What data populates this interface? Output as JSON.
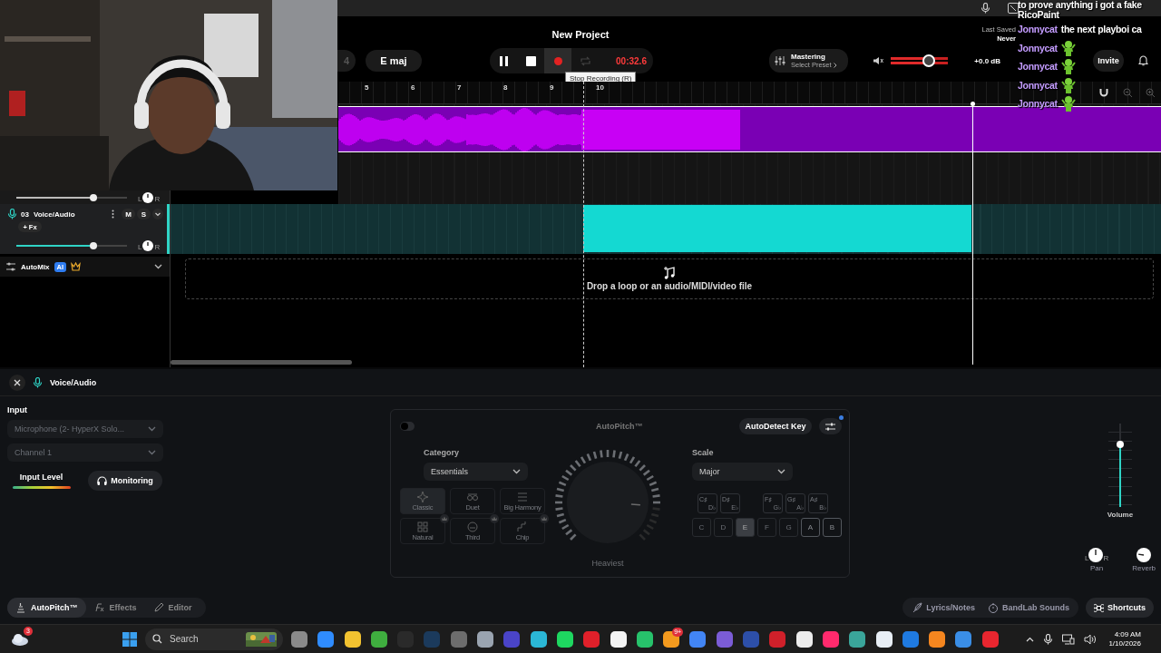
{
  "chat": [
    {
      "kind": "text",
      "text": "to prove anything i got a fake"
    },
    {
      "kind": "text",
      "text": "RicoPaint"
    },
    {
      "kind": "message",
      "user": "Jonnycat",
      "text": "the next playboi ca"
    },
    {
      "kind": "emote",
      "user": "Jonnycat"
    },
    {
      "kind": "emote",
      "user": "Jonnycat"
    },
    {
      "kind": "emote",
      "user": "Jonnycat"
    },
    {
      "kind": "emote",
      "user": "Jonnycat"
    }
  ],
  "toolbar": {
    "title": "New Project",
    "bar": "4",
    "key": "E maj",
    "transport": [
      {
        "kind": "pause",
        "on": false,
        "disabled": false
      },
      {
        "kind": "stop",
        "on": false,
        "disabled": false
      },
      {
        "kind": "record",
        "on": true,
        "disabled": false
      },
      {
        "kind": "loop",
        "on": false,
        "disabled": true
      }
    ],
    "time": "00:32.6",
    "tooltip": "Stop Recording (R)",
    "mastering": {
      "title": "Mastering",
      "subtitle": "Select Preset"
    },
    "master_volume": {
      "level": 0.67
    },
    "gain": "+0.0 dB",
    "last_saved": {
      "label": "Last Saved",
      "value": "Never"
    },
    "invite": "Invite"
  },
  "ruler": {
    "labels": [
      "5",
      "6",
      "7",
      "8",
      "9",
      "10"
    ]
  },
  "tracks": [
    {
      "color": "#7a00b4"
    },
    {
      "volume": {
        "level": 0.7
      },
      "pan": {
        "left": "L",
        "right": "R"
      }
    },
    {
      "number": "03",
      "name": "Voice/Audio",
      "fx": "+ Fx",
      "mute": "M",
      "solo": "S",
      "selected": true,
      "color": "#14d9d2",
      "volume": {
        "level": 0.7
      },
      "pan": {
        "left": "L",
        "right": "R"
      }
    }
  ],
  "automix": {
    "label": "AutoMix",
    "badge": "AI"
  },
  "drop_zone": {
    "text": "Drop a loop or an audio/MIDI/video file"
  },
  "editor": {
    "track": {
      "name": "Voice/Audio"
    },
    "input": {
      "label": "Input",
      "device": "Microphone (2- HyperX Solo...",
      "channel": "Channel 1",
      "level_label": "Input Level",
      "monitoring": "Monitoring"
    },
    "autopitch": {
      "enabled": false,
      "title": "AutoPitch™",
      "autodetect": "AutoDetect Key",
      "category_label": "Category",
      "category": "Essentials",
      "presets": [
        {
          "label": "Classic",
          "selected": true,
          "locked": false
        },
        {
          "label": "Duet",
          "selected": false,
          "locked": false
        },
        {
          "label": "Big Harmony",
          "selected": false,
          "locked": false
        },
        {
          "label": "Natural",
          "selected": false,
          "locked": true
        },
        {
          "label": "Third",
          "selected": false,
          "locked": true
        },
        {
          "label": "Chip",
          "selected": false,
          "locked": true
        }
      ],
      "knob": {
        "label": "Heaviest"
      },
      "scale_label": "Scale",
      "scale": "Major",
      "sharps": [
        {
          "top": "C♯",
          "bottom": "D♭"
        },
        {
          "top": "D♯",
          "bottom": "E♭"
        },
        {
          "top": "F♯",
          "bottom": "G♭"
        },
        {
          "top": "G♯",
          "bottom": "A♭"
        },
        {
          "top": "A♯",
          "bottom": "B♭"
        }
      ],
      "notes": [
        {
          "label": "C",
          "selected": false,
          "highlighted": false
        },
        {
          "label": "D",
          "selected": false,
          "highlighted": false
        },
        {
          "label": "E",
          "selected": true,
          "highlighted": false
        },
        {
          "label": "F",
          "selected": false,
          "highlighted": false
        },
        {
          "label": "G",
          "selected": false,
          "highlighted": false
        },
        {
          "label": "A",
          "selected": false,
          "highlighted": true
        },
        {
          "label": "B",
          "selected": false,
          "highlighted": true
        }
      ]
    },
    "mixer": {
      "volume": {
        "label": "Volume",
        "level": 0.75
      },
      "pan": {
        "label": "Pan",
        "left": "L",
        "right": "R"
      },
      "reverb": {
        "label": "Reverb"
      }
    },
    "tabs": [
      {
        "label": "AutoPitch™",
        "selected": true
      },
      {
        "label": "Effects",
        "selected": false
      },
      {
        "label": "Editor",
        "selected": false
      }
    ],
    "links": [
      "Lyrics/Notes",
      "BandLab Sounds"
    ],
    "shortcuts": "Shortcuts"
  },
  "taskbar": {
    "weather_badge": "3",
    "search": {
      "placeholder": "Search"
    },
    "apps": [
      {
        "color": "#8a8a8a"
      },
      {
        "color": "#2f8cff"
      },
      {
        "color": "#f2c230"
      },
      {
        "color": "#3fae3f"
      },
      {
        "color": "#2a2a2a"
      },
      {
        "color": "#1b3a5c"
      },
      {
        "color": "#6d6d6d"
      },
      {
        "color": "#9aa4b0"
      },
      {
        "color": "#4a44c8"
      },
      {
        "color": "#2bb7d6"
      },
      {
        "color": "#1ed760"
      },
      {
        "color": "#e0202a"
      },
      {
        "color": "#f4f4f4"
      },
      {
        "color": "#27c26b"
      },
      {
        "color": "#f39a1e",
        "badge": "9+"
      },
      {
        "color": "#4285f4"
      },
      {
        "color": "#7b5cd6"
      },
      {
        "color": "#2d4fa8"
      },
      {
        "color": "#d0202a"
      },
      {
        "color": "#ececec"
      },
      {
        "color": "#ff2a6d"
      },
      {
        "color": "#3aa59a"
      },
      {
        "color": "#e8eef5"
      },
      {
        "color": "#1f7ae0"
      },
      {
        "color": "#f5861f"
      },
      {
        "color": "#3a8ee6"
      },
      {
        "color": "#e8262f"
      }
    ],
    "time": "4:09 AM",
    "date": "1/10/2026"
  }
}
